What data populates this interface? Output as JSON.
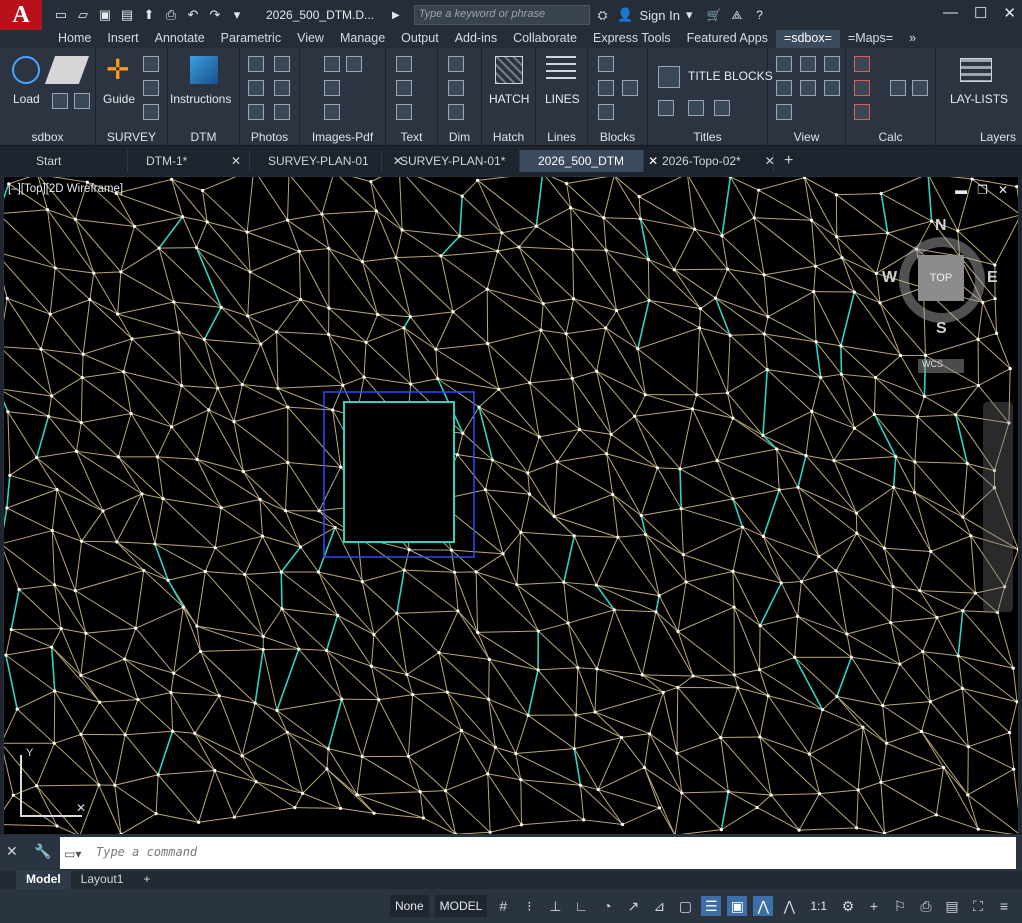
{
  "app": {
    "logo": "A",
    "title": "2026_500_DTM.D...",
    "search_placeholder": "Type a keyword or phrase",
    "signin": "Sign In"
  },
  "ribbon_tabs": [
    "Home",
    "Insert",
    "Annotate",
    "Parametric",
    "View",
    "Manage",
    "Output",
    "Add-ins",
    "Collaborate",
    "Express Tools",
    "Featured Apps",
    "=sdbox=",
    "=Maps="
  ],
  "ribbon": {
    "load": "Load",
    "guide": "Guide",
    "instructions": "Instructions",
    "hatch": "HATCH",
    "lines": "LINES",
    "title_blocks": "TITLE BLOCKS",
    "lay_lists": "LAY-LISTS",
    "panels": [
      "sdbox",
      "SURVEY",
      "DTM",
      "Photos",
      "Images-Pdf",
      "Text",
      "Dim",
      "Hatch",
      "Lines",
      "Blocks",
      "Titles",
      "View",
      "Calc",
      "Layers"
    ]
  },
  "doc_tabs": [
    "Start",
    "DTM-1*",
    "SURVEY-PLAN-01",
    "SURVEY-PLAN-01*",
    "2026_500_DTM",
    "2026-Topo-02*"
  ],
  "viewport": {
    "label": "[–][Top][2D Wireframe]",
    "cube_top": "TOP",
    "n": "N",
    "s": "S",
    "e": "E",
    "w": "W",
    "wcs": "WCS"
  },
  "command": {
    "placeholder": "Type a command"
  },
  "layouts": [
    "Model",
    "Layout1"
  ],
  "status": {
    "none": "None",
    "model": "MODEL",
    "scale": "1:1"
  }
}
